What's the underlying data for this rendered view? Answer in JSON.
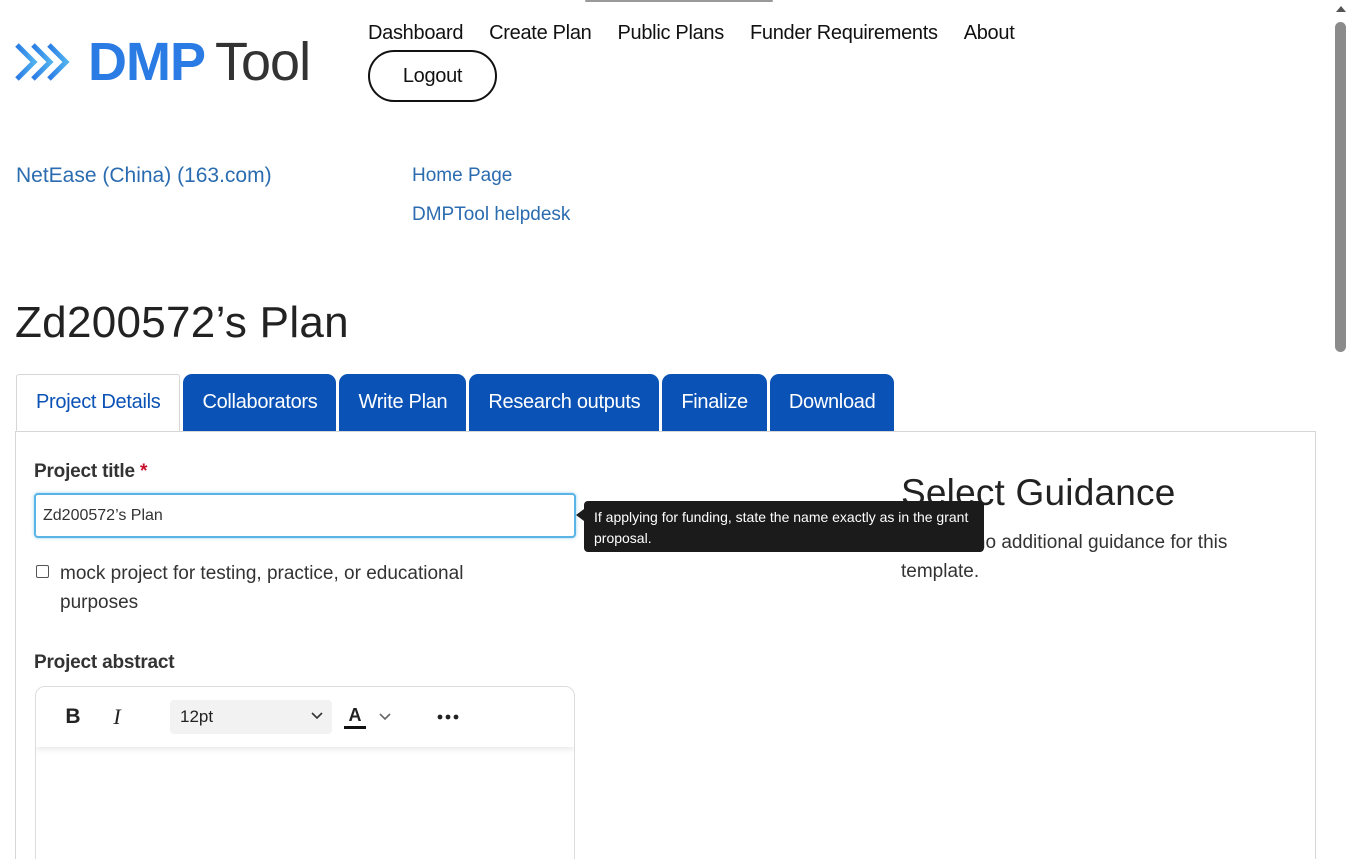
{
  "header": {
    "logo": {
      "brand": "DMP",
      "product": "Tool"
    },
    "nav": [
      {
        "label": "Dashboard"
      },
      {
        "label": "Create Plan"
      },
      {
        "label": "Public Plans"
      },
      {
        "label": "Funder Requirements"
      },
      {
        "label": "About"
      }
    ],
    "logout_label": "Logout"
  },
  "org": {
    "name": "NetEase (China) (163.com)",
    "links": [
      {
        "label": "Home Page"
      },
      {
        "label": "DMPTool helpdesk"
      }
    ]
  },
  "page": {
    "title": "Zd200572’s Plan"
  },
  "tabs": [
    {
      "label": "Project Details",
      "active": true
    },
    {
      "label": "Collaborators",
      "active": false
    },
    {
      "label": "Write Plan",
      "active": false
    },
    {
      "label": "Research outputs",
      "active": false
    },
    {
      "label": "Finalize",
      "active": false
    },
    {
      "label": "Download",
      "active": false
    }
  ],
  "form": {
    "project_title": {
      "label": "Project title",
      "required_mark": "*",
      "value": "Zd200572’s Plan"
    },
    "tooltip": "If applying for funding, state the name exactly as in the grant proposal.",
    "mock_project": {
      "label": "mock project for testing, practice, or educational purposes",
      "checked": false
    },
    "abstract": {
      "label": "Project abstract",
      "toolbar": {
        "bold": "B",
        "italic": "I",
        "font_size": "12pt",
        "text_color_letter": "A",
        "more": "•••"
      }
    }
  },
  "guidance": {
    "title": "Select Guidance",
    "text": "There is no additional guidance for this template."
  },
  "colors": {
    "brand_blue": "#2a7be4",
    "tab_blue": "#0a52b5",
    "link_blue": "#2b6cb0",
    "focus_ring": "#5ab4e6",
    "required_red": "#c8102e",
    "tooltip_bg": "#1b1b1b"
  },
  "icons": {
    "logo": "double-chevron-right-icon",
    "dropdown": "chevron-down-icon",
    "more": "ellipsis-icon"
  }
}
